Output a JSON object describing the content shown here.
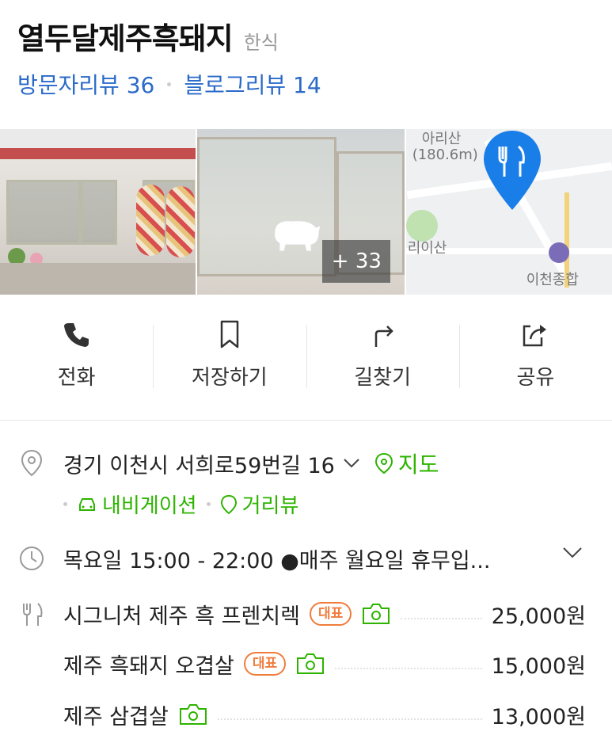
{
  "header": {
    "title": "열두달제주흑돼지",
    "category": "한식",
    "visitor_review": "방문자리뷰 36",
    "blog_review": "블로그리뷰 14"
  },
  "photos": {
    "more_count": "+ 33",
    "map_labels": [
      "아리산",
      "(180.6m)",
      "리이산",
      "이천종합"
    ]
  },
  "actions": [
    {
      "label": "전화",
      "icon": "phone-icon"
    },
    {
      "label": "저장하기",
      "icon": "bookmark-icon"
    },
    {
      "label": "길찾기",
      "icon": "directions-icon"
    },
    {
      "label": "공유",
      "icon": "share-icon"
    }
  ],
  "address": {
    "text": "경기 이천시 서희로59번길 16",
    "map_link": "지도",
    "navigation_link": "내비게이션",
    "street_view_link": "거리뷰"
  },
  "hours": {
    "text": "목요일 15:00 - 22:00 ●매주 월요일 휴무입..."
  },
  "menu": [
    {
      "name": "시그니처 제주 흑 프렌치렉",
      "badge": "대표",
      "price": "25,000원"
    },
    {
      "name": "제주 흑돼지 오겹살",
      "badge": "대표",
      "price": "15,000원"
    },
    {
      "name": "제주 삼겹살",
      "badge": "",
      "price": "13,000원"
    }
  ],
  "colors": {
    "link_blue": "#2a6ac8",
    "naver_green": "#2db400",
    "badge_orange": "#f07c3c",
    "pin_blue": "#1a7ee8"
  }
}
